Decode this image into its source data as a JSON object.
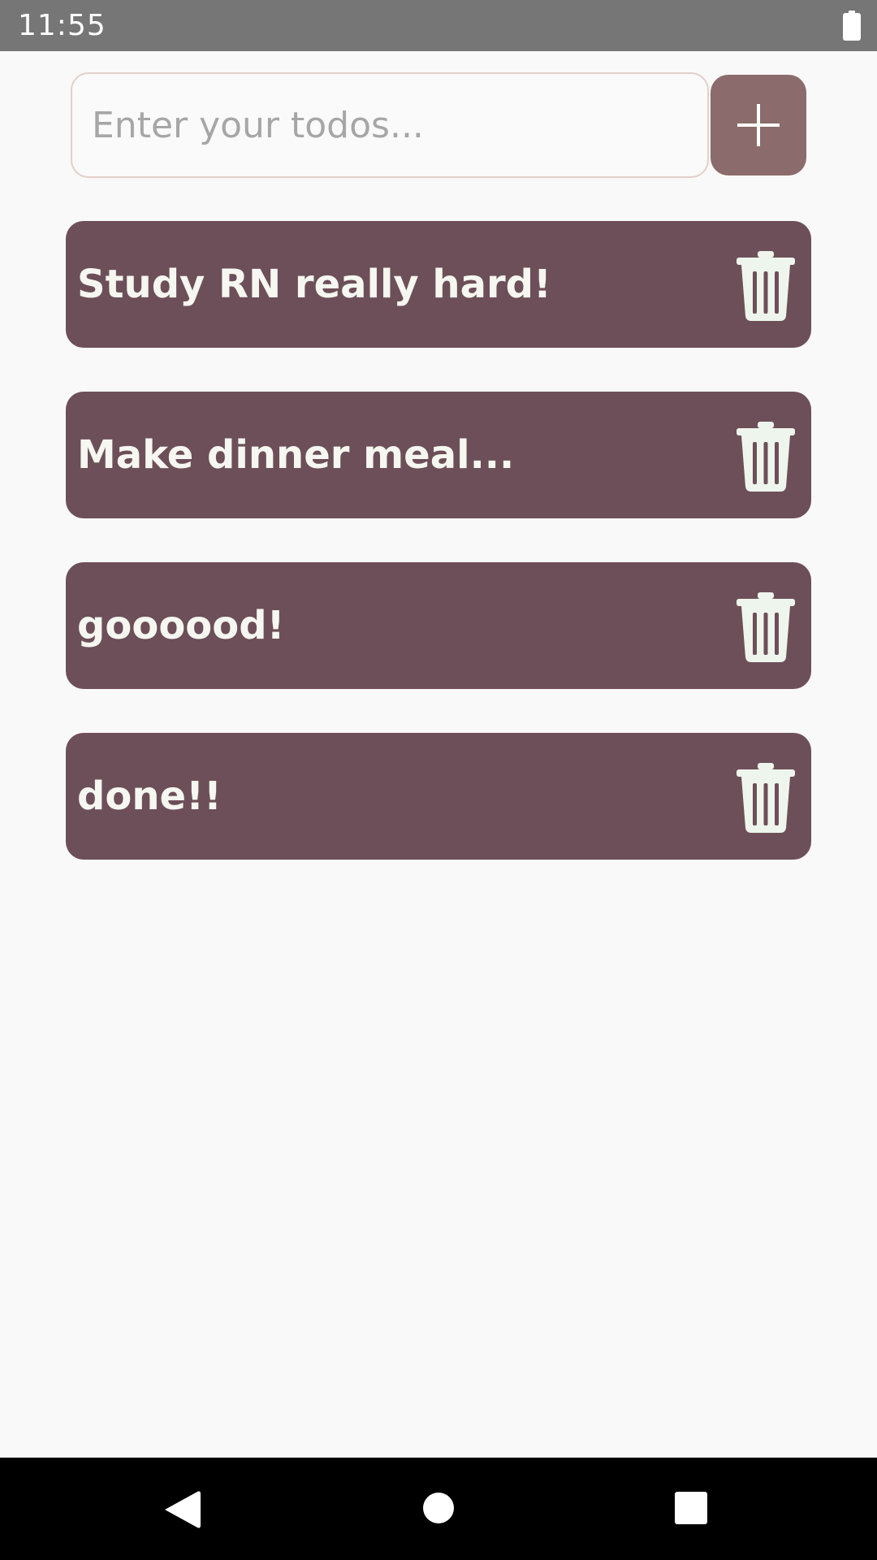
{
  "status_bar": {
    "time": "11:55",
    "battery_icon": "battery-full-icon"
  },
  "input": {
    "placeholder": "Enter your todos...",
    "value": ""
  },
  "add_button": {
    "icon": "plus-icon"
  },
  "todos": [
    {
      "text": "Study RN really hard!",
      "delete_icon": "trash-icon"
    },
    {
      "text": "Make dinner meal...",
      "delete_icon": "trash-icon"
    },
    {
      "text": "goooood!",
      "delete_icon": "trash-icon"
    },
    {
      "text": "done!!",
      "delete_icon": "trash-icon"
    }
  ],
  "nav_bar": {
    "back_icon": "back-triangle-icon",
    "home_icon": "home-circle-icon",
    "recents_icon": "recents-square-icon"
  },
  "colors": {
    "status_bar": "#767676",
    "background": "#f9f9f9",
    "input_border": "#e3cfca",
    "add_button": "#8b6b6b",
    "todo_item": "#6d4f59",
    "todo_text": "#f5f7f0",
    "nav_bar": "#000000"
  }
}
